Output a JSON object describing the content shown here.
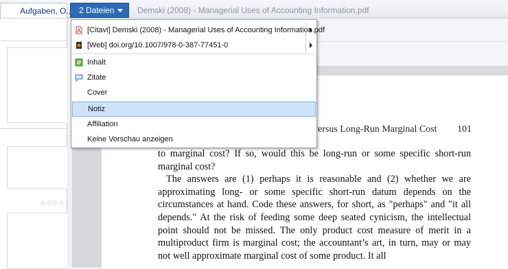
{
  "tabs": {
    "left_tab_label": "Aufgaben, O...",
    "preview_dropdown_label": "2 Dateien",
    "preview_title": "Demski (2008) - Managerial Uses of Accounting Information.pdf"
  },
  "left_pane": {
    "rating_stars": "☆☆☆☆☆"
  },
  "menu": {
    "items": [
      {
        "label": "[Citavi] Demski (2008) - Managerial Uses of Accounting Information.pdf",
        "icon": "pdf-icon",
        "submenu": true
      },
      {
        "label": "[Web] doi.org/10.1007/978-0-387-77451-0",
        "icon": "web-document-icon",
        "submenu": true
      },
      {
        "label": "Inhalt",
        "icon": "contents-icon"
      },
      {
        "label": "Zitate",
        "icon": "quotes-icon"
      },
      {
        "label": "Cover",
        "icon": ""
      },
      {
        "label": "Notiz",
        "icon": "",
        "selected": true
      },
      {
        "label": "Affiliation",
        "icon": ""
      },
      {
        "label": "Keine Vorschau anzeigen",
        "icon": ""
      }
    ]
  },
  "document": {
    "header": "versus Long-Run Marginal Cost",
    "page_number": "101",
    "paragraph1": "to marginal cost? If so, would this be long-run or some specific short-run marginal cost?",
    "paragraph2": "The answers are (1) perhaps it is reasonable and (2) whether we are approximating long- or some specific short-run datum depends on the circumstances at hand. Code these answers, for short, as \"perhaps\" and \"it all depends.\" At the risk of feeding some deep seated cynicism, the intellectual point should not be missed. The only product cost measure of merit in a multiproduct firm is marginal cost; the accountant’s art, in turn, may or may not well approximate marginal cost of some product. It all"
  },
  "colors": {
    "accent": "#2d6bb7",
    "selection": "#cfe3f8"
  }
}
